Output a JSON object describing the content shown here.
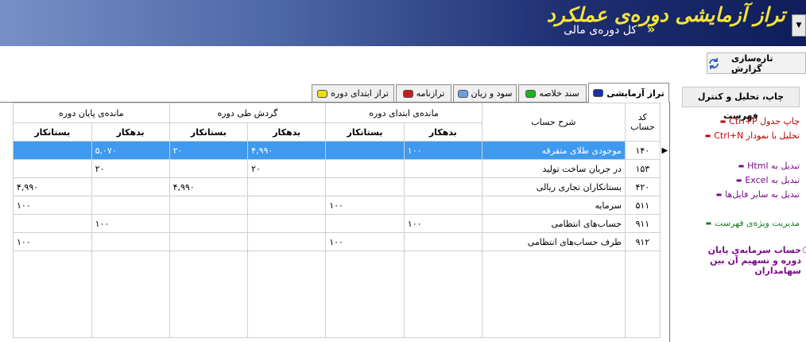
{
  "header": {
    "title": "تراز آزمایشی دوره‌ی عملکرد",
    "arrow": "»",
    "subtitle": "کل دوره‌ی مالی",
    "dropdown_glyph": "▼"
  },
  "toolbar": {
    "refresh_label": "تازه‌سازی گزارش"
  },
  "tabs": [
    {
      "label": "تراز آزمایشی",
      "color": "#1a2fa8",
      "active": true
    },
    {
      "label": "سند خلاصه",
      "color": "#1fb01f"
    },
    {
      "label": "سود و زیان",
      "color": "#6f9ee0"
    },
    {
      "label": "ترازنامه",
      "color": "#c81c1c"
    },
    {
      "label": "تراز ابتدای دوره",
      "color": "#e6e015"
    }
  ],
  "side": {
    "header": "چاپ، تحلیل و کنترل فهرست",
    "links": [
      {
        "label": "چاپ جدول  Ctrl+P",
        "bullet": "▬",
        "color": "red"
      },
      {
        "label": "تحلیل با نمودار  Ctrl+N",
        "bullet": "▬",
        "color": "red"
      },
      {
        "label": "تبدیل به Html",
        "bullet": "▬",
        "color": "purple"
      },
      {
        "label": "تبدیل به Excel",
        "bullet": "▬",
        "color": "purple"
      },
      {
        "label": "تبدیل به سایر فایل‌ها",
        "bullet": "▬",
        "color": "purple"
      },
      {
        "label": "مدیریت ویژه‌ی فهرست",
        "bullet": "▬",
        "color": "green"
      }
    ],
    "capital_text": "حساب سرمایه‌ی پایان دوره و تسهیم آن بین سهامداران",
    "capital_bullet": "○"
  },
  "table": {
    "group_headers": {
      "end_balance": "مانده‌ی پایان دوره",
      "turnover": "گردش طی دوره",
      "start_balance": "مانده‌ی ابتدای دوره"
    },
    "col_creditor": "بستانکار",
    "col_debtor": "بدهکار",
    "col_description": "شرح حساب",
    "col_code": "کد حساب",
    "sort_glyph": "▲",
    "row_marker": "▶",
    "rows": [
      {
        "code": "۱۴۰",
        "desc": "موجودی طلای متفرقه",
        "start_debit": "۱۰۰",
        "start_credit": "",
        "turn_debit": "۴,۹۹۰",
        "turn_credit": "۲۰",
        "end_debit": "۵,۰۷۰",
        "end_credit": "",
        "selected": true
      },
      {
        "code": "۱۵۳",
        "desc": "در جریان ساخت تولید",
        "start_debit": "",
        "start_credit": "",
        "turn_debit": "۲۰",
        "turn_credit": "",
        "end_debit": "۲۰",
        "end_credit": ""
      },
      {
        "code": "۴۲۰",
        "desc": "بستانکاران تجاری ریالی",
        "start_debit": "",
        "start_credit": "",
        "turn_debit": "",
        "turn_credit": "۴,۹۹۰",
        "end_debit": "",
        "end_credit": "۴,۹۹۰"
      },
      {
        "code": "۵۱۱",
        "desc": "سرمایه",
        "start_debit": "",
        "start_credit": "۱۰۰",
        "turn_debit": "",
        "turn_credit": "",
        "end_debit": "",
        "end_credit": "۱۰۰"
      },
      {
        "code": "۹۱۱",
        "desc": "حساب‌های انتظامی",
        "start_debit": "۱۰۰",
        "start_credit": "",
        "turn_debit": "",
        "turn_credit": "",
        "end_debit": "۱۰۰",
        "end_credit": ""
      },
      {
        "code": "۹۱۲",
        "desc": "طرف حساب‌های انتظامی",
        "start_debit": "",
        "start_credit": "۱۰۰",
        "turn_debit": "",
        "turn_credit": "",
        "end_debit": "",
        "end_credit": "۱۰۰"
      }
    ]
  }
}
